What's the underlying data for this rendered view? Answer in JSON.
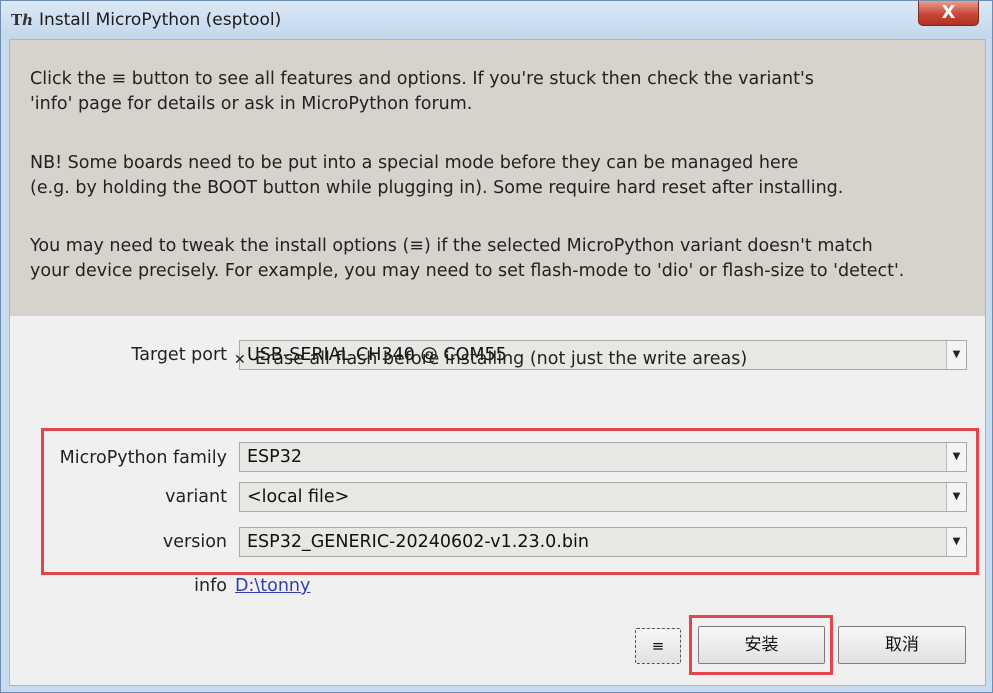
{
  "window": {
    "app_icon": "Tℎ",
    "title": "Install MicroPython (esptool)",
    "close_label": "X"
  },
  "info": {
    "para1_line1": "Click the ≡ button to see all features and options. If you're stuck then check the variant's",
    "para1_line2": "'info' page for details or ask in MicroPython forum.",
    "para2_line1": "NB! Some boards need to be put into a special mode before they can be managed here",
    "para2_line2": "(e.g. by holding the BOOT button while plugging in). Some require hard reset after installing.",
    "para3_line1": "You may need to tweak the install options (≡) if the selected MicroPython variant doesn't match",
    "para3_line2": "your device precisely. For example, you may need to set flash-mode to 'dio' or flash-size to 'detect'."
  },
  "form": {
    "target_port_label": "Target port",
    "target_port_value": "USB-SERIAL CH340 @ COM55",
    "erase_checked_glyph": "✕",
    "erase_label": "Erase all flash before installing (not just the write areas)",
    "family_label": "MicroPython family",
    "family_value": "ESP32",
    "variant_label": "variant",
    "variant_value": "<local file>",
    "version_label": "version",
    "version_value": "ESP32_GENERIC-20240602-v1.23.0.bin",
    "info_label": "info",
    "info_link": "D:\\tonny",
    "dropdown_arrow": "▼"
  },
  "buttons": {
    "menu_label": "≡",
    "install_label": "安装",
    "cancel_label": "取消"
  },
  "colors": {
    "highlight": "#e3454c",
    "link": "#2f3fb0",
    "info_panel_bg": "#d6d3cd"
  }
}
